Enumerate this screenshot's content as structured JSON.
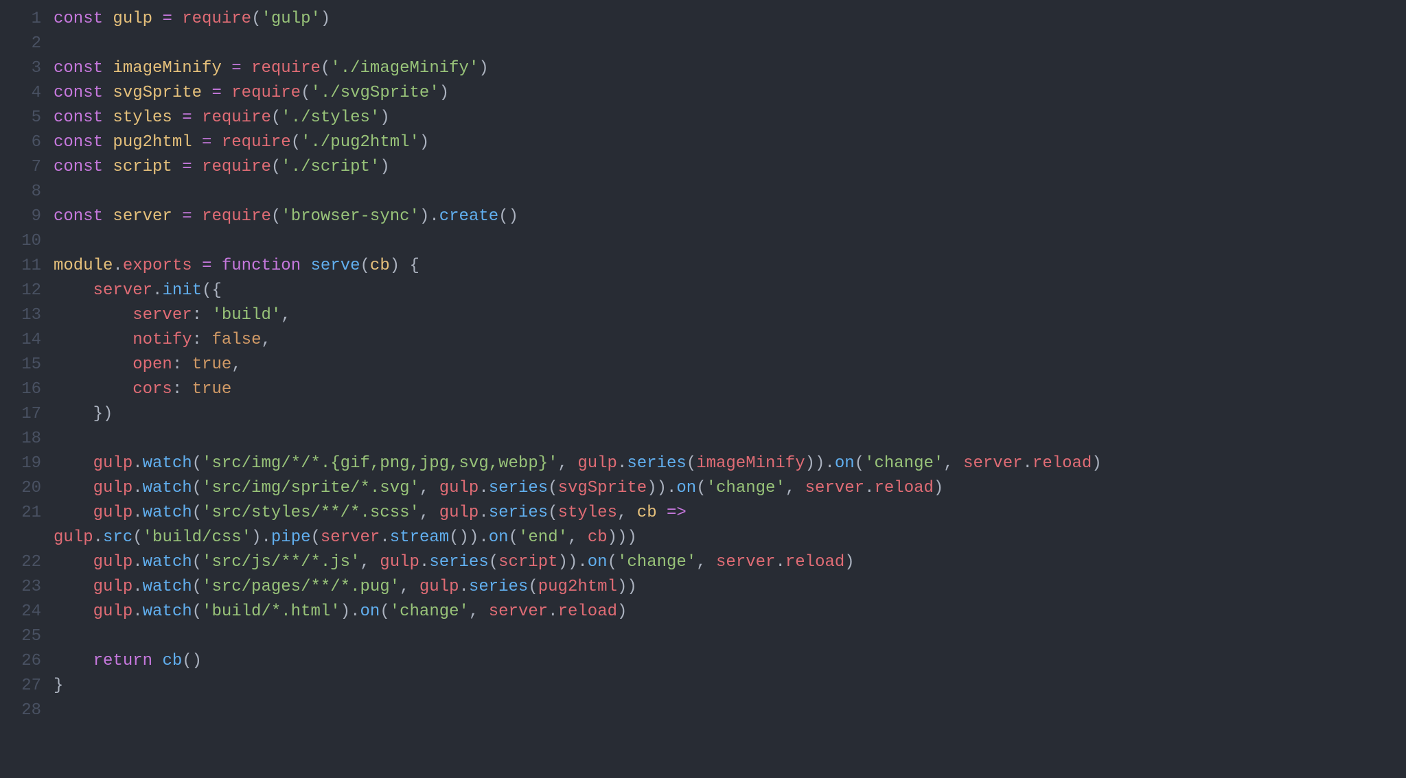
{
  "lines": [
    {
      "n": 1,
      "tokens": [
        {
          "c": "tok-keyword",
          "t": "const"
        },
        {
          "c": "tok-plain",
          "t": " "
        },
        {
          "c": "tok-const",
          "t": "gulp"
        },
        {
          "c": "tok-plain",
          "t": " "
        },
        {
          "c": "tok-operator",
          "t": "="
        },
        {
          "c": "tok-plain",
          "t": " "
        },
        {
          "c": "tok-funcred",
          "t": "require"
        },
        {
          "c": "tok-punct",
          "t": "("
        },
        {
          "c": "tok-string",
          "t": "'gulp'"
        },
        {
          "c": "tok-punct",
          "t": ")"
        }
      ]
    },
    {
      "n": 2,
      "tokens": []
    },
    {
      "n": 3,
      "tokens": [
        {
          "c": "tok-keyword",
          "t": "const"
        },
        {
          "c": "tok-plain",
          "t": " "
        },
        {
          "c": "tok-const",
          "t": "imageMinify"
        },
        {
          "c": "tok-plain",
          "t": " "
        },
        {
          "c": "tok-operator",
          "t": "="
        },
        {
          "c": "tok-plain",
          "t": " "
        },
        {
          "c": "tok-funcred",
          "t": "require"
        },
        {
          "c": "tok-punct",
          "t": "("
        },
        {
          "c": "tok-string",
          "t": "'./imageMinify'"
        },
        {
          "c": "tok-punct",
          "t": ")"
        }
      ]
    },
    {
      "n": 4,
      "tokens": [
        {
          "c": "tok-keyword",
          "t": "const"
        },
        {
          "c": "tok-plain",
          "t": " "
        },
        {
          "c": "tok-const",
          "t": "svgSprite"
        },
        {
          "c": "tok-plain",
          "t": " "
        },
        {
          "c": "tok-operator",
          "t": "="
        },
        {
          "c": "tok-plain",
          "t": " "
        },
        {
          "c": "tok-funcred",
          "t": "require"
        },
        {
          "c": "tok-punct",
          "t": "("
        },
        {
          "c": "tok-string",
          "t": "'./svgSprite'"
        },
        {
          "c": "tok-punct",
          "t": ")"
        }
      ]
    },
    {
      "n": 5,
      "tokens": [
        {
          "c": "tok-keyword",
          "t": "const"
        },
        {
          "c": "tok-plain",
          "t": " "
        },
        {
          "c": "tok-const",
          "t": "styles"
        },
        {
          "c": "tok-plain",
          "t": " "
        },
        {
          "c": "tok-operator",
          "t": "="
        },
        {
          "c": "tok-plain",
          "t": " "
        },
        {
          "c": "tok-funcred",
          "t": "require"
        },
        {
          "c": "tok-punct",
          "t": "("
        },
        {
          "c": "tok-string",
          "t": "'./styles'"
        },
        {
          "c": "tok-punct",
          "t": ")"
        }
      ]
    },
    {
      "n": 6,
      "tokens": [
        {
          "c": "tok-keyword",
          "t": "const"
        },
        {
          "c": "tok-plain",
          "t": " "
        },
        {
          "c": "tok-const",
          "t": "pug2html"
        },
        {
          "c": "tok-plain",
          "t": " "
        },
        {
          "c": "tok-operator",
          "t": "="
        },
        {
          "c": "tok-plain",
          "t": " "
        },
        {
          "c": "tok-funcred",
          "t": "require"
        },
        {
          "c": "tok-punct",
          "t": "("
        },
        {
          "c": "tok-string",
          "t": "'./pug2html'"
        },
        {
          "c": "tok-punct",
          "t": ")"
        }
      ]
    },
    {
      "n": 7,
      "tokens": [
        {
          "c": "tok-keyword",
          "t": "const"
        },
        {
          "c": "tok-plain",
          "t": " "
        },
        {
          "c": "tok-const",
          "t": "script"
        },
        {
          "c": "tok-plain",
          "t": " "
        },
        {
          "c": "tok-operator",
          "t": "="
        },
        {
          "c": "tok-plain",
          "t": " "
        },
        {
          "c": "tok-funcred",
          "t": "require"
        },
        {
          "c": "tok-punct",
          "t": "("
        },
        {
          "c": "tok-string",
          "t": "'./script'"
        },
        {
          "c": "tok-punct",
          "t": ")"
        }
      ]
    },
    {
      "n": 8,
      "tokens": []
    },
    {
      "n": 9,
      "tokens": [
        {
          "c": "tok-keyword",
          "t": "const"
        },
        {
          "c": "tok-plain",
          "t": " "
        },
        {
          "c": "tok-const",
          "t": "server"
        },
        {
          "c": "tok-plain",
          "t": " "
        },
        {
          "c": "tok-operator",
          "t": "="
        },
        {
          "c": "tok-plain",
          "t": " "
        },
        {
          "c": "tok-funcred",
          "t": "require"
        },
        {
          "c": "tok-punct",
          "t": "("
        },
        {
          "c": "tok-string",
          "t": "'browser-sync'"
        },
        {
          "c": "tok-punct",
          "t": ")."
        },
        {
          "c": "tok-func",
          "t": "create"
        },
        {
          "c": "tok-punct",
          "t": "()"
        }
      ]
    },
    {
      "n": 10,
      "tokens": []
    },
    {
      "n": 11,
      "tokens": [
        {
          "c": "tok-module",
          "t": "module"
        },
        {
          "c": "tok-punct",
          "t": "."
        },
        {
          "c": "tok-prop",
          "t": "exports"
        },
        {
          "c": "tok-plain",
          "t": " "
        },
        {
          "c": "tok-operator",
          "t": "="
        },
        {
          "c": "tok-plain",
          "t": " "
        },
        {
          "c": "tok-keyword",
          "t": "function"
        },
        {
          "c": "tok-plain",
          "t": " "
        },
        {
          "c": "tok-func",
          "t": "serve"
        },
        {
          "c": "tok-punct",
          "t": "("
        },
        {
          "c": "tok-param",
          "t": "cb"
        },
        {
          "c": "tok-punct",
          "t": ") {"
        }
      ]
    },
    {
      "n": 12,
      "tokens": [
        {
          "c": "tok-plain",
          "t": "    "
        },
        {
          "c": "tok-prop",
          "t": "server"
        },
        {
          "c": "tok-punct",
          "t": "."
        },
        {
          "c": "tok-func",
          "t": "init"
        },
        {
          "c": "tok-punct",
          "t": "({"
        }
      ]
    },
    {
      "n": 13,
      "tokens": [
        {
          "c": "tok-plain",
          "t": "        "
        },
        {
          "c": "tok-prop",
          "t": "server"
        },
        {
          "c": "tok-punct",
          "t": ": "
        },
        {
          "c": "tok-string",
          "t": "'build'"
        },
        {
          "c": "tok-punct",
          "t": ","
        }
      ]
    },
    {
      "n": 14,
      "tokens": [
        {
          "c": "tok-plain",
          "t": "        "
        },
        {
          "c": "tok-prop",
          "t": "notify"
        },
        {
          "c": "tok-punct",
          "t": ": "
        },
        {
          "c": "tok-bool",
          "t": "false"
        },
        {
          "c": "tok-punct",
          "t": ","
        }
      ]
    },
    {
      "n": 15,
      "tokens": [
        {
          "c": "tok-plain",
          "t": "        "
        },
        {
          "c": "tok-prop",
          "t": "open"
        },
        {
          "c": "tok-punct",
          "t": ": "
        },
        {
          "c": "tok-bool",
          "t": "true"
        },
        {
          "c": "tok-punct",
          "t": ","
        }
      ]
    },
    {
      "n": 16,
      "tokens": [
        {
          "c": "tok-plain",
          "t": "        "
        },
        {
          "c": "tok-prop",
          "t": "cors"
        },
        {
          "c": "tok-punct",
          "t": ": "
        },
        {
          "c": "tok-bool",
          "t": "true"
        }
      ]
    },
    {
      "n": 17,
      "tokens": [
        {
          "c": "tok-plain",
          "t": "    "
        },
        {
          "c": "tok-punct",
          "t": "})"
        }
      ]
    },
    {
      "n": 18,
      "tokens": []
    },
    {
      "n": 19,
      "tokens": [
        {
          "c": "tok-plain",
          "t": "    "
        },
        {
          "c": "tok-prop",
          "t": "gulp"
        },
        {
          "c": "tok-punct",
          "t": "."
        },
        {
          "c": "tok-func",
          "t": "watch"
        },
        {
          "c": "tok-punct",
          "t": "("
        },
        {
          "c": "tok-string",
          "t": "'src/img/*/*.{gif,png,jpg,svg,webp}'"
        },
        {
          "c": "tok-punct",
          "t": ", "
        },
        {
          "c": "tok-prop",
          "t": "gulp"
        },
        {
          "c": "tok-punct",
          "t": "."
        },
        {
          "c": "tok-func",
          "t": "series"
        },
        {
          "c": "tok-punct",
          "t": "("
        },
        {
          "c": "tok-prop",
          "t": "imageMinify"
        },
        {
          "c": "tok-punct",
          "t": "))."
        },
        {
          "c": "tok-func",
          "t": "on"
        },
        {
          "c": "tok-punct",
          "t": "("
        },
        {
          "c": "tok-string",
          "t": "'change'"
        },
        {
          "c": "tok-punct",
          "t": ", "
        },
        {
          "c": "tok-prop",
          "t": "server"
        },
        {
          "c": "tok-punct",
          "t": "."
        },
        {
          "c": "tok-prop",
          "t": "reload"
        },
        {
          "c": "tok-punct",
          "t": ")"
        }
      ]
    },
    {
      "n": 20,
      "tokens": [
        {
          "c": "tok-plain",
          "t": "    "
        },
        {
          "c": "tok-prop",
          "t": "gulp"
        },
        {
          "c": "tok-punct",
          "t": "."
        },
        {
          "c": "tok-func",
          "t": "watch"
        },
        {
          "c": "tok-punct",
          "t": "("
        },
        {
          "c": "tok-string",
          "t": "'src/img/sprite/*.svg'"
        },
        {
          "c": "tok-punct",
          "t": ", "
        },
        {
          "c": "tok-prop",
          "t": "gulp"
        },
        {
          "c": "tok-punct",
          "t": "."
        },
        {
          "c": "tok-func",
          "t": "series"
        },
        {
          "c": "tok-punct",
          "t": "("
        },
        {
          "c": "tok-prop",
          "t": "svgSprite"
        },
        {
          "c": "tok-punct",
          "t": "))."
        },
        {
          "c": "tok-func",
          "t": "on"
        },
        {
          "c": "tok-punct",
          "t": "("
        },
        {
          "c": "tok-string",
          "t": "'change'"
        },
        {
          "c": "tok-punct",
          "t": ", "
        },
        {
          "c": "tok-prop",
          "t": "server"
        },
        {
          "c": "tok-punct",
          "t": "."
        },
        {
          "c": "tok-prop",
          "t": "reload"
        },
        {
          "c": "tok-punct",
          "t": ")"
        }
      ]
    },
    {
      "n": 21,
      "tokens": [
        {
          "c": "tok-plain",
          "t": "    "
        },
        {
          "c": "tok-prop",
          "t": "gulp"
        },
        {
          "c": "tok-punct",
          "t": "."
        },
        {
          "c": "tok-func",
          "t": "watch"
        },
        {
          "c": "tok-punct",
          "t": "("
        },
        {
          "c": "tok-string",
          "t": "'src/styles/**/*.scss'"
        },
        {
          "c": "tok-punct",
          "t": ", "
        },
        {
          "c": "tok-prop",
          "t": "gulp"
        },
        {
          "c": "tok-punct",
          "t": "."
        },
        {
          "c": "tok-func",
          "t": "series"
        },
        {
          "c": "tok-punct",
          "t": "("
        },
        {
          "c": "tok-prop",
          "t": "styles"
        },
        {
          "c": "tok-punct",
          "t": ", "
        },
        {
          "c": "tok-param",
          "t": "cb"
        },
        {
          "c": "tok-plain",
          "t": " "
        },
        {
          "c": "tok-keyword",
          "t": "=>"
        }
      ]
    },
    {
      "n": "",
      "tokens": [
        {
          "c": "tok-prop",
          "t": "gulp"
        },
        {
          "c": "tok-punct",
          "t": "."
        },
        {
          "c": "tok-func",
          "t": "src"
        },
        {
          "c": "tok-punct",
          "t": "("
        },
        {
          "c": "tok-string",
          "t": "'build/css'"
        },
        {
          "c": "tok-punct",
          "t": ")."
        },
        {
          "c": "tok-func",
          "t": "pipe"
        },
        {
          "c": "tok-punct",
          "t": "("
        },
        {
          "c": "tok-prop",
          "t": "server"
        },
        {
          "c": "tok-punct",
          "t": "."
        },
        {
          "c": "tok-func",
          "t": "stream"
        },
        {
          "c": "tok-punct",
          "t": "())."
        },
        {
          "c": "tok-func",
          "t": "on"
        },
        {
          "c": "tok-punct",
          "t": "("
        },
        {
          "c": "tok-string",
          "t": "'end'"
        },
        {
          "c": "tok-punct",
          "t": ", "
        },
        {
          "c": "tok-prop",
          "t": "cb"
        },
        {
          "c": "tok-punct",
          "t": ")))"
        }
      ]
    },
    {
      "n": 22,
      "tokens": [
        {
          "c": "tok-plain",
          "t": "    "
        },
        {
          "c": "tok-prop",
          "t": "gulp"
        },
        {
          "c": "tok-punct",
          "t": "."
        },
        {
          "c": "tok-func",
          "t": "watch"
        },
        {
          "c": "tok-punct",
          "t": "("
        },
        {
          "c": "tok-string",
          "t": "'src/js/**/*.js'"
        },
        {
          "c": "tok-punct",
          "t": ", "
        },
        {
          "c": "tok-prop",
          "t": "gulp"
        },
        {
          "c": "tok-punct",
          "t": "."
        },
        {
          "c": "tok-func",
          "t": "series"
        },
        {
          "c": "tok-punct",
          "t": "("
        },
        {
          "c": "tok-prop",
          "t": "script"
        },
        {
          "c": "tok-punct",
          "t": "))."
        },
        {
          "c": "tok-func",
          "t": "on"
        },
        {
          "c": "tok-punct",
          "t": "("
        },
        {
          "c": "tok-string",
          "t": "'change'"
        },
        {
          "c": "tok-punct",
          "t": ", "
        },
        {
          "c": "tok-prop",
          "t": "server"
        },
        {
          "c": "tok-punct",
          "t": "."
        },
        {
          "c": "tok-prop",
          "t": "reload"
        },
        {
          "c": "tok-punct",
          "t": ")"
        }
      ]
    },
    {
      "n": 23,
      "tokens": [
        {
          "c": "tok-plain",
          "t": "    "
        },
        {
          "c": "tok-prop",
          "t": "gulp"
        },
        {
          "c": "tok-punct",
          "t": "."
        },
        {
          "c": "tok-func",
          "t": "watch"
        },
        {
          "c": "tok-punct",
          "t": "("
        },
        {
          "c": "tok-string",
          "t": "'src/pages/**/*.pug'"
        },
        {
          "c": "tok-punct",
          "t": ", "
        },
        {
          "c": "tok-prop",
          "t": "gulp"
        },
        {
          "c": "tok-punct",
          "t": "."
        },
        {
          "c": "tok-func",
          "t": "series"
        },
        {
          "c": "tok-punct",
          "t": "("
        },
        {
          "c": "tok-prop",
          "t": "pug2html"
        },
        {
          "c": "tok-punct",
          "t": "))"
        }
      ]
    },
    {
      "n": 24,
      "tokens": [
        {
          "c": "tok-plain",
          "t": "    "
        },
        {
          "c": "tok-prop",
          "t": "gulp"
        },
        {
          "c": "tok-punct",
          "t": "."
        },
        {
          "c": "tok-func",
          "t": "watch"
        },
        {
          "c": "tok-punct",
          "t": "("
        },
        {
          "c": "tok-string",
          "t": "'build/*.html'"
        },
        {
          "c": "tok-punct",
          "t": ")."
        },
        {
          "c": "tok-func",
          "t": "on"
        },
        {
          "c": "tok-punct",
          "t": "("
        },
        {
          "c": "tok-string",
          "t": "'change'"
        },
        {
          "c": "tok-punct",
          "t": ", "
        },
        {
          "c": "tok-prop",
          "t": "server"
        },
        {
          "c": "tok-punct",
          "t": "."
        },
        {
          "c": "tok-prop",
          "t": "reload"
        },
        {
          "c": "tok-punct",
          "t": ")"
        }
      ]
    },
    {
      "n": 25,
      "tokens": []
    },
    {
      "n": 26,
      "tokens": [
        {
          "c": "tok-plain",
          "t": "    "
        },
        {
          "c": "tok-keyword",
          "t": "return"
        },
        {
          "c": "tok-plain",
          "t": " "
        },
        {
          "c": "tok-func",
          "t": "cb"
        },
        {
          "c": "tok-punct",
          "t": "()"
        }
      ]
    },
    {
      "n": 27,
      "tokens": [
        {
          "c": "tok-punct",
          "t": "}"
        }
      ]
    },
    {
      "n": 28,
      "tokens": []
    }
  ]
}
